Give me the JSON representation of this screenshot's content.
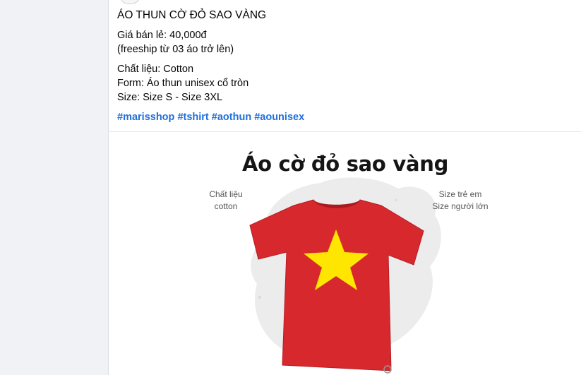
{
  "post": {
    "title": "ÁO THUN CỜ ĐỎ SAO VÀNG",
    "price_line": "Giá bán lẻ: 40,000đ",
    "freeship_line": "(freeship từ 03 áo trở lên)",
    "material_line": "Chất liệu: Cotton",
    "form_line": "Form: Áo thun unisex cổ tròn",
    "size_line": "Size: Size S - Size 3XL",
    "hashtags": [
      "#marisshop",
      "#tshirt",
      "#aothun",
      "#aounisex"
    ]
  },
  "photo": {
    "heading": "Áo cờ đỏ sao vàng",
    "left_label": [
      "Chất liệu",
      "cotton"
    ],
    "right_label": [
      "Size trẻ em",
      "Size người lớn"
    ]
  },
  "colors": {
    "hashtag": "#216fdb",
    "shirt_red": "#d7282e",
    "star_yellow": "#ffe600"
  }
}
